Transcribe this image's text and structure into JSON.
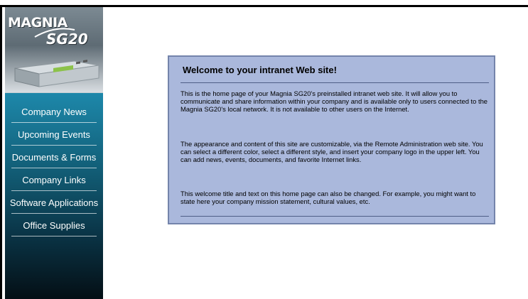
{
  "brand": {
    "logo_line1": "MAGNIA",
    "logo_line2": "SG20"
  },
  "sidebar": {
    "items": [
      {
        "label": "Company News"
      },
      {
        "label": "Upcoming Events"
      },
      {
        "label": "Documents & Forms"
      },
      {
        "label": "Company Links"
      },
      {
        "label": "Software Applications"
      },
      {
        "label": "Office Supplies"
      }
    ]
  },
  "main": {
    "title": "Welcome to your intranet Web site!",
    "paragraphs": [
      "This is the home page of your Magnia SG20's preinstalled intranet web site. It will allow you to communicate and share information within your company and is available only to users connected to the Magnia SG20's local network. It is not available to other users on the Internet.",
      "The appearance and content of this site are customizable, via the Remote Administration web site. You can select a different color, select a different style, and insert your company logo in the upper left. You can add news, events, documents, and favorite Internet links.",
      "This welcome title and text on this home page can also be changed. For example, you might want to state here your company mission statement, cultural values, etc."
    ]
  },
  "colors": {
    "sidebar_top": "#2fa6c9",
    "sidebar_bottom": "#040f15",
    "content_bg": "#aab8dc",
    "content_border": "#7484ab"
  }
}
